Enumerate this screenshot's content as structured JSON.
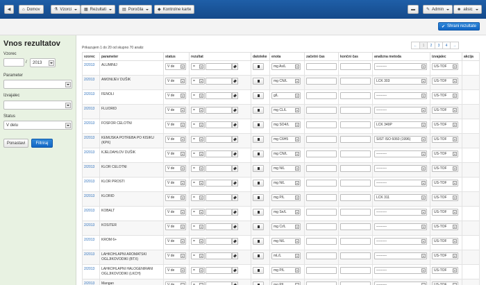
{
  "nav": {
    "back_icon": "arrow-left-icon",
    "home_label": "Domov",
    "samples_label": "Vzorci",
    "results_label": "Rezultati",
    "reports_label": "Poročila",
    "cards_label": "Kontrolne karte",
    "admin_label": "Admin",
    "user_label": "alisic"
  },
  "toolbar": {
    "save_label": "Shrani rezultate"
  },
  "sidebar": {
    "title": "Vnos rezultatov",
    "sample_label": "Vzorec",
    "sample_value": "",
    "year_sep": "/",
    "year_value": "2013",
    "parameter_label": "Parameter",
    "parameter_value": "",
    "executor_label": "Izvajalec",
    "executor_value": "",
    "status_label": "Status",
    "status_value": "V delu",
    "reset_label": "Ponastavi",
    "filter_label": "Filtriraj"
  },
  "summary": "Prikazujem 1 do 20 od skupno 70 analiz",
  "pager": [
    "←",
    "1",
    "2",
    "3",
    "4",
    "→"
  ],
  "columns": [
    "vzorec",
    "parameter",
    "status",
    "rezultat",
    "datoteke",
    "enota",
    "začetni čas",
    "končni čas",
    "analizna metoda",
    "izvajalec",
    "akcija"
  ],
  "rows": [
    {
      "sample": "2/2013",
      "param": "ALUMINIJ",
      "status": "V de",
      "op": "=",
      "unit": "mg As/L",
      "method": "---------",
      "exec": "US-TOF"
    },
    {
      "sample": "2/2013",
      "param": "AMONIJEV DUŠIK",
      "status": "V de",
      "op": "=",
      "unit": "mg CN/L",
      "method": "LCK 303",
      "exec": "US-TOF"
    },
    {
      "sample": "2/2013",
      "param": "FENOLI",
      "status": "V de",
      "op": "=",
      "unit": "g/L",
      "method": "---------",
      "exec": "US-TOF"
    },
    {
      "sample": "2/2013",
      "param": "FLUORID",
      "status": "V de",
      "op": "=",
      "unit": "mg CL/L",
      "method": "---------",
      "exec": "US-TOF"
    },
    {
      "sample": "2/2013",
      "param": "FOSFOR CELOTNI",
      "status": "V de",
      "op": "=",
      "unit": "mg SO4/L",
      "method": "LCK 349P",
      "exec": "US-TOF"
    },
    {
      "sample": "2/2013",
      "param": "KEMIJSKA POTREBA PO KISIKU (KPK)",
      "status": "V de",
      "op": "=",
      "unit": "mg C6H5",
      "method": "SIST ISO 6060 (1996)",
      "exec": "US-TOF"
    },
    {
      "sample": "2/2013",
      "param": "KJELDAHLOV DUŠIK",
      "status": "V de",
      "op": "=",
      "unit": "mg CN/L",
      "method": "---------",
      "exec": "US-TOF"
    },
    {
      "sample": "2/2013",
      "param": "KLOR CELOTNI",
      "status": "V de",
      "op": "=",
      "unit": "mg N/L",
      "method": "---------",
      "exec": "US-TOF"
    },
    {
      "sample": "2/2013",
      "param": "KLOR PROSTI",
      "status": "V de",
      "op": "=",
      "unit": "mg N/L",
      "method": "---------",
      "exec": "US-TOF"
    },
    {
      "sample": "2/2013",
      "param": "KLORID",
      "status": "V de",
      "op": "=",
      "unit": "mg P/L",
      "method": "LCK 311",
      "exec": "US-TOF"
    },
    {
      "sample": "2/2013",
      "param": "KOBALT",
      "status": "V de",
      "op": "=",
      "unit": "mg Sn/L",
      "method": "---------",
      "exec": "US-TOF"
    },
    {
      "sample": "2/2013",
      "param": "KOSITER",
      "status": "V de",
      "op": "=",
      "unit": "mg Cr/L",
      "method": "---------",
      "exec": "US-TOF"
    },
    {
      "sample": "2/2013",
      "param": "KROM 6+",
      "status": "V de",
      "op": "=",
      "unit": "mg N/L",
      "method": "---------",
      "exec": "US-TOF"
    },
    {
      "sample": "2/2013",
      "param": "LAHKOHLAPNI AROMATSKI OGLJIKOVODIKI (BTX)",
      "status": "V de",
      "op": "=",
      "unit": "mL/L",
      "method": "---------",
      "exec": "US-TOF"
    },
    {
      "sample": "2/2013",
      "param": "LAHKOHLAPNI HALOGENIRANI OGLJIKOVODIKI (LKCH)",
      "status": "V de",
      "op": "=",
      "unit": "mg P/L",
      "method": "---------",
      "exec": "US-TOF"
    },
    {
      "sample": "2/2013",
      "param": "Mangan",
      "status": "V de",
      "op": "=",
      "unit": "mg P/L",
      "method": "---------",
      "exec": "US-TOF"
    }
  ]
}
